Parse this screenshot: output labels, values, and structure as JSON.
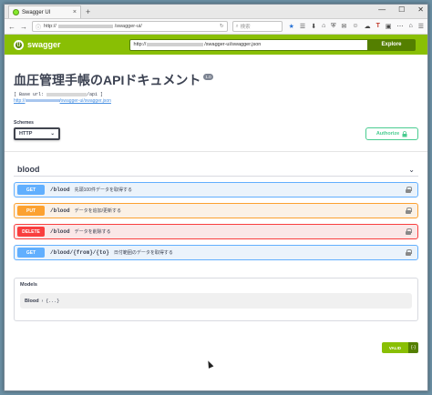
{
  "browser": {
    "tab_title": "Swagger UI",
    "tab_close": "×",
    "new_tab": "+",
    "win_controls": [
      "—",
      "☐",
      "✕"
    ],
    "back": "←",
    "forward": "→",
    "info": "ⓘ",
    "url_prefix": "http://",
    "url_suffix": "/swagger-ui/",
    "reload": "↻",
    "search_placeholder": "検索",
    "search_icon": "search-icon",
    "toolbar_icons": [
      "★",
      "☰",
      "⬇",
      "⌂",
      "⛨",
      "✉",
      "☺",
      "☁",
      "T",
      "▣",
      "⋯",
      "⌂",
      "☰"
    ]
  },
  "swagger_bar": {
    "logo_text": "swagger",
    "logo_glyph": "{}",
    "spec_url_prefix": "http://",
    "spec_url_suffix": "/swagger-ui/swagger.json",
    "explore_label": "Explore"
  },
  "info": {
    "title": "血圧管理手帳のAPIドキュメント",
    "version": "1.0",
    "base_url_prefix": "[ Base url: ",
    "base_url_suffix": "/api ]",
    "spec_link_prefix": "http://",
    "spec_link_suffix": "/swagger-ui/swagger.json"
  },
  "schemes": {
    "label": "Schemes",
    "selected": "HTTP",
    "caret": "⌄"
  },
  "authorize": {
    "label": "Authorize",
    "icon": "lock-icon"
  },
  "tag": {
    "name": "blood",
    "chevron": "⌄"
  },
  "operations": [
    {
      "method": "GET",
      "path": "/blood",
      "summary": "先頭100件データを取得する"
    },
    {
      "method": "PUT",
      "path": "/blood",
      "summary": "データを追加/更新する"
    },
    {
      "method": "DELETE",
      "path": "/blood",
      "summary": "データを削除する"
    },
    {
      "method": "GET",
      "path": "/blood/{from}/{to}",
      "summary": "日付範囲のデータを取得する"
    }
  ],
  "models": {
    "title": "Models",
    "items": [
      {
        "name": "Blood",
        "arrow": "›",
        "braces": "{...}"
      }
    ]
  },
  "validator": {
    "label": "VALID",
    "icon_text": "{-}"
  },
  "colors": {
    "swagger_green": "#89bf04",
    "get": "#61affe",
    "put": "#fca130",
    "delete": "#f93e3e",
    "authorize": "#49cc90"
  }
}
